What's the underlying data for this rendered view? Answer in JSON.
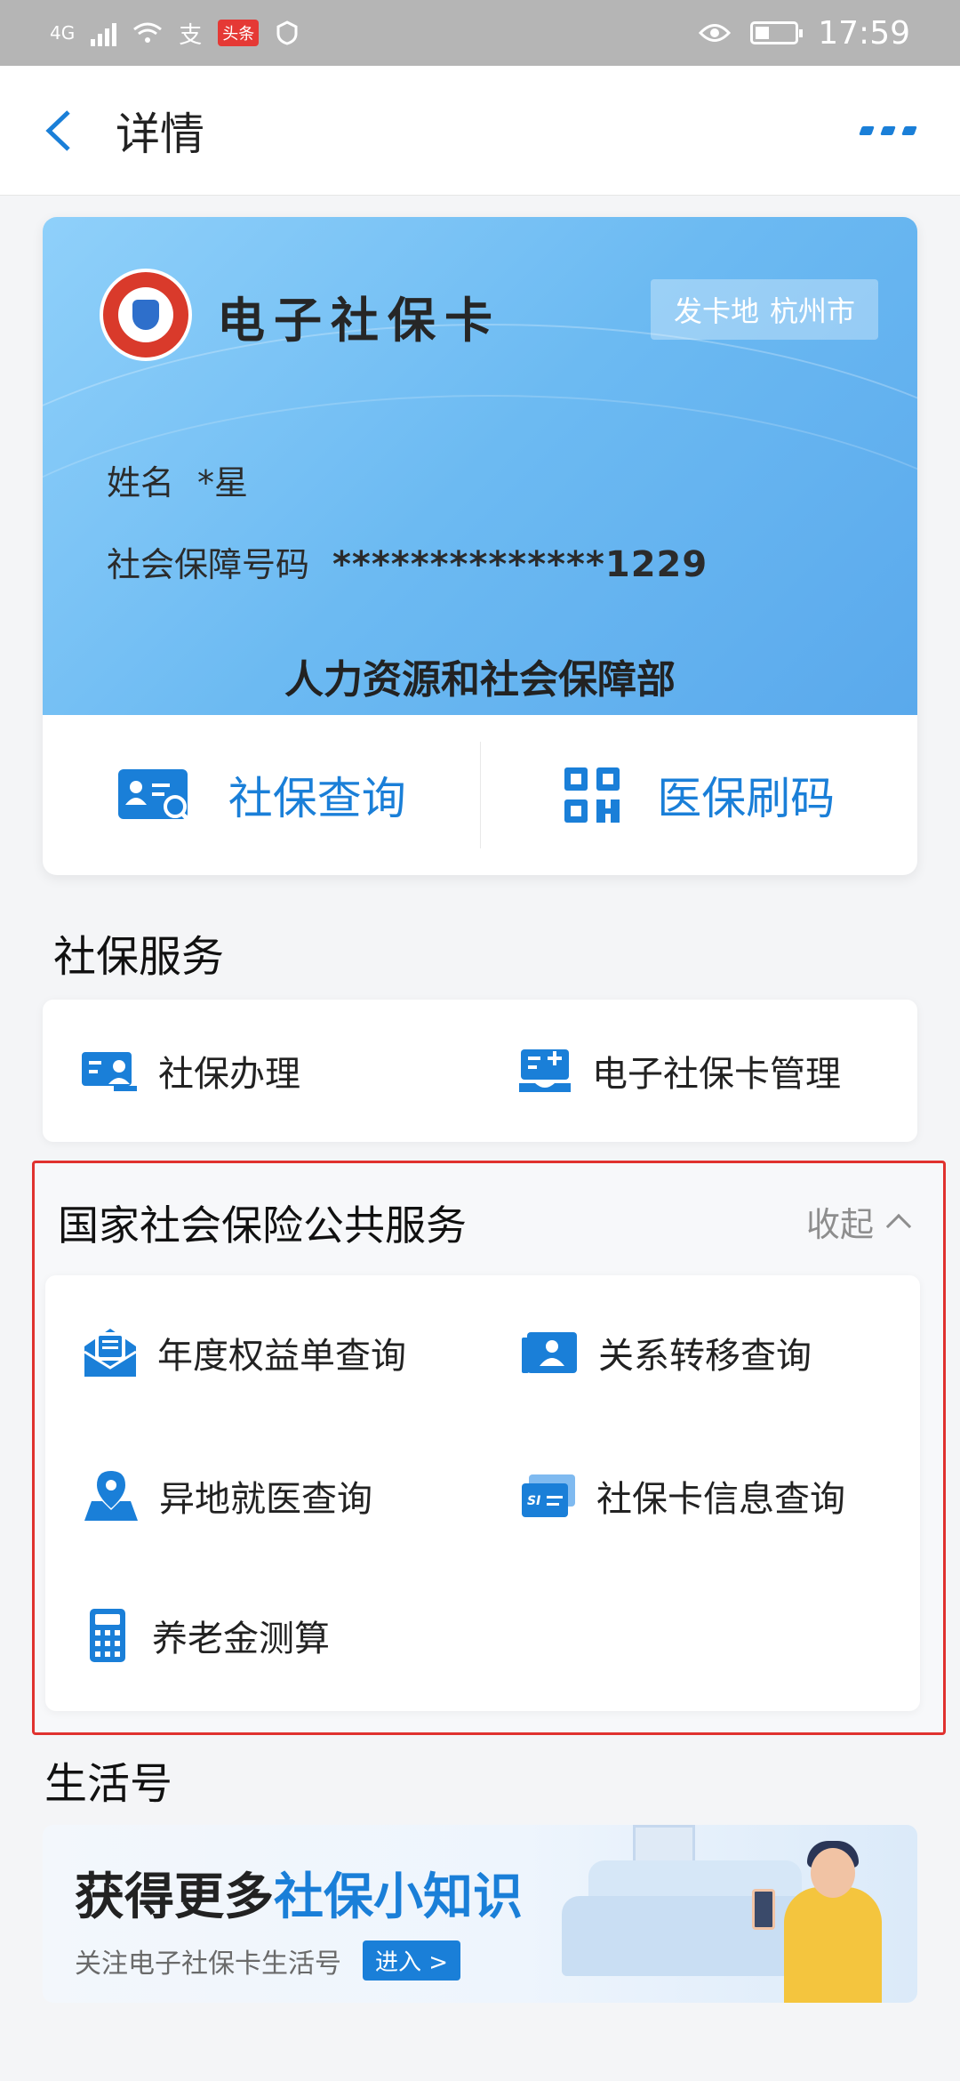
{
  "status_bar": {
    "network": "4G",
    "app_badge": "头条",
    "alipay_glyph": "支",
    "time": "17:59"
  },
  "nav": {
    "title": "详情"
  },
  "card": {
    "title": "电子社保卡",
    "issuer_label": "发卡地",
    "issuer_city": "杭州市",
    "name_label": "姓名",
    "name_value": "*星",
    "id_label": "社会保障号码",
    "id_value": "**************1229",
    "ministry": "人力资源和社会保障部"
  },
  "quick_actions": {
    "query": "社保查询",
    "pay_code": "医保刷码"
  },
  "social_services": {
    "heading": "社保服务",
    "items": [
      "社保办理",
      "电子社保卡管理"
    ]
  },
  "national_services": {
    "heading": "国家社会保险公共服务",
    "collapse_label": "收起",
    "items": [
      "年度权益单查询",
      "关系转移查询",
      "异地就医查询",
      "社保卡信息查询",
      "养老金测算"
    ]
  },
  "life_account": {
    "heading": "生活号",
    "banner_title_prefix": "获得更多",
    "banner_title_highlight": "社保小知识",
    "banner_sub": "关注电子社保卡生活号",
    "enter_label": "进入 >"
  },
  "colors": {
    "accent": "#1a7fd8",
    "highlight_border": "#e0322f",
    "status_bar": "#b5b5b5"
  }
}
